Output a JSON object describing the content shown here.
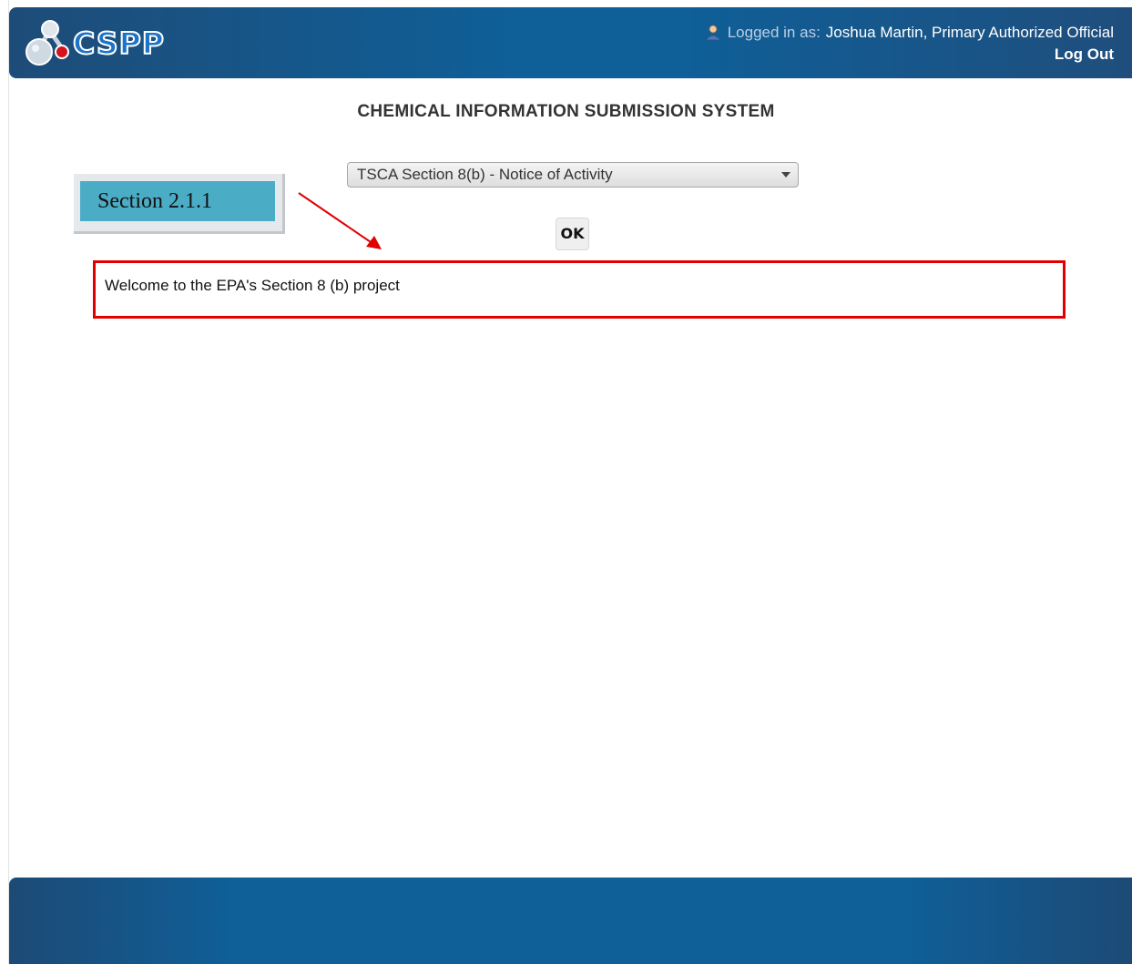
{
  "header": {
    "logo_text": "CSPP",
    "logged_in_label": "Logged in as:",
    "user_name": "Joshua Martin, Primary Authorized Official",
    "logout_label": "Log Out",
    "icons": {
      "logo": "molecule-logo-icon",
      "user": "user-icon"
    }
  },
  "main": {
    "system_title": "CHEMICAL INFORMATION SUBMISSION SYSTEM",
    "program_select": {
      "selected": "TSCA Section 8(b) - Notice of Activity"
    },
    "ok_label": "OK",
    "welcome_text": "Welcome to the EPA's Section 8 (b) project"
  },
  "annotation": {
    "section_label": "Section 2.1.1",
    "highlight_color": "#e00000",
    "callout_color": "#4bacc6"
  },
  "colors": {
    "header_blue": "#0f5f98",
    "footer_blue": "#0f5f98"
  }
}
